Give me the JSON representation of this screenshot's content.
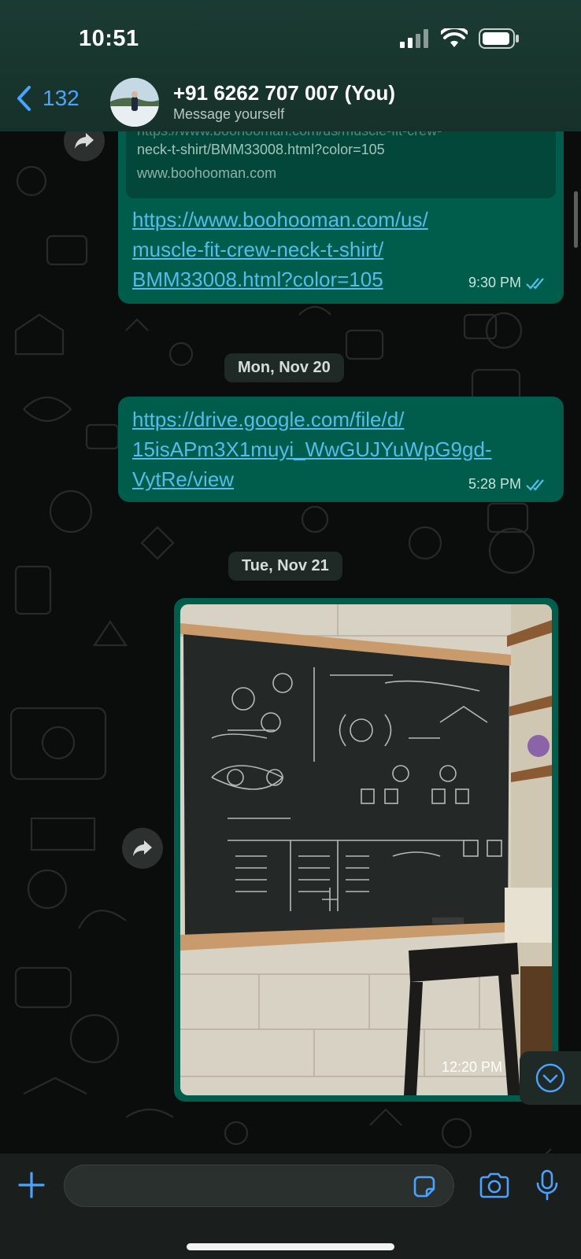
{
  "status_bar": {
    "time": "10:51"
  },
  "header": {
    "back_count": "132",
    "contact_name": "+91 6262 707 007 (You)",
    "contact_subtitle": "Message yourself"
  },
  "messages": [
    {
      "preview_line1": "https://www.boohooman.com/us/muscle-fit-crew-",
      "preview_line2": "neck-t-shirt/BMM33008.html?color=105",
      "preview_domain": "www.boohooman.com",
      "link_lines": [
        "https://www.boohooman.com/us/",
        "muscle-fit-crew-neck-t-shirt/",
        "BMM33008.html?color=105"
      ],
      "time": "9:30 PM"
    },
    {
      "link_lines": [
        "https://drive.google.com/file/d/",
        "15isAPm3X1muyi_WwGUJYuWpG9gd-",
        "VytRe/view"
      ],
      "time": "5:28 PM"
    },
    {
      "type": "image",
      "time": "12:20 PM"
    }
  ],
  "date_chips": [
    "Mon, Nov 20",
    "Tue, Nov 21"
  ],
  "composer": {
    "placeholder": ""
  },
  "colors": {
    "accent": "#4aa3ff",
    "bubble": "#005c4b",
    "link": "#53bdeb",
    "read_ticks": "#53bdeb"
  }
}
